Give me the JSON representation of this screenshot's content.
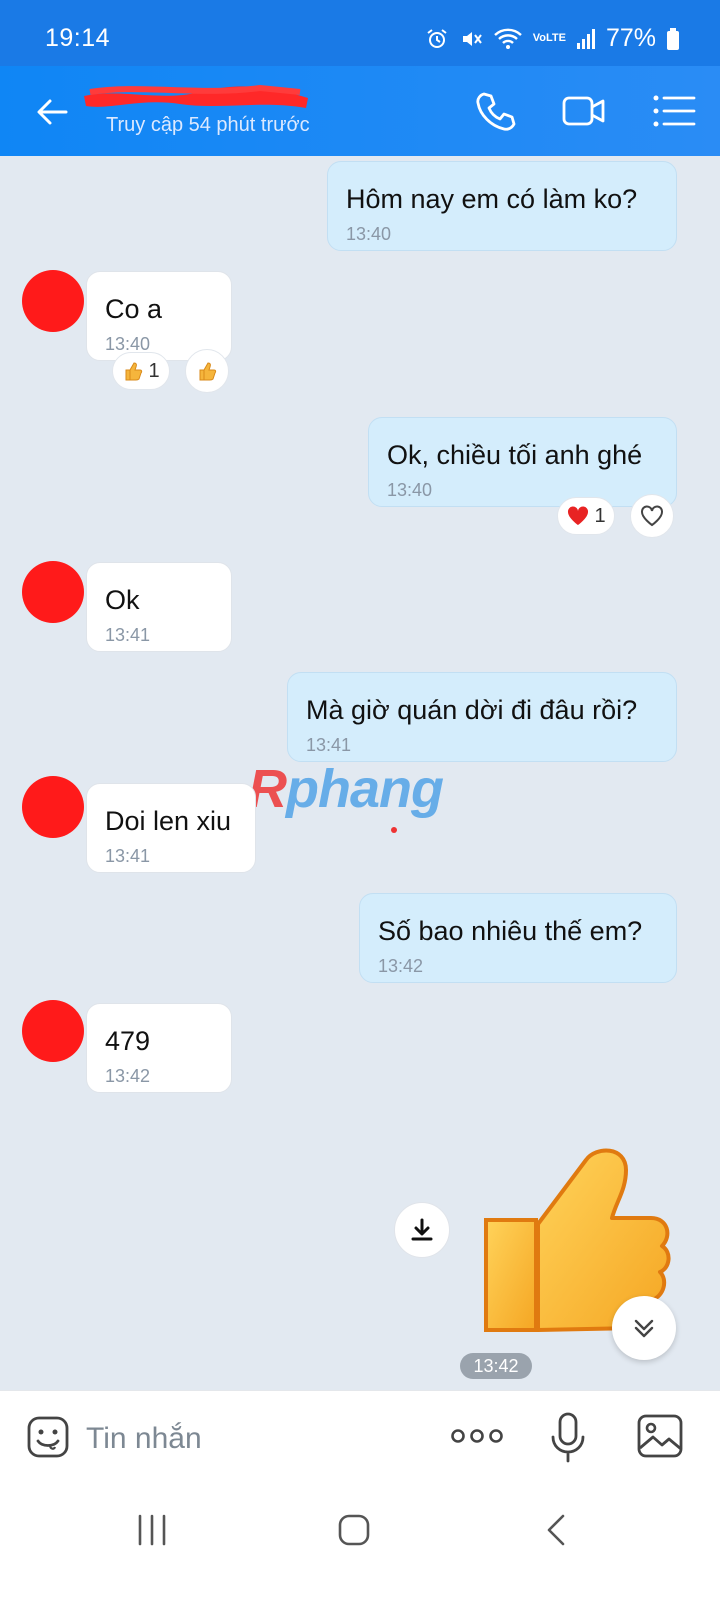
{
  "status_bar": {
    "time": "19:14",
    "battery_percent": "77%",
    "network_label": "VoLTE"
  },
  "header": {
    "last_seen": "Truy cập 54 phút trước"
  },
  "messages": [
    {
      "direction": "out",
      "text": "Hôm nay em có làm ko?",
      "time": "13:40"
    },
    {
      "direction": "in",
      "text": "Co a",
      "time": "13:40",
      "reactions": [
        {
          "emoji": "thumbs-up",
          "count": "1"
        },
        {
          "emoji": "thumbs-up",
          "count": ""
        }
      ]
    },
    {
      "direction": "out",
      "text": "Ok, chiều tối anh ghé",
      "time": "13:40",
      "reactions": [
        {
          "emoji": "red-heart",
          "count": "1"
        },
        {
          "emoji": "heart-outline",
          "count": ""
        }
      ]
    },
    {
      "direction": "in",
      "text": "Ok",
      "time": "13:41"
    },
    {
      "direction": "out",
      "text": "Mà giờ quán dời đi đâu rồi?",
      "time": "13:41"
    },
    {
      "direction": "in",
      "text": "Doi len xiu",
      "time": "13:41"
    },
    {
      "direction": "out",
      "text": "Số bao nhiêu thế em?",
      "time": "13:42"
    },
    {
      "direction": "in",
      "text": "479",
      "time": "13:42"
    }
  ],
  "sticker": {
    "name": "thumbs-up-sticker",
    "time": "13:42"
  },
  "watermark": {
    "first": "R",
    "rest": "phang"
  },
  "input": {
    "placeholder": "Tin nhắn"
  },
  "colors": {
    "header": "#1a86f5",
    "outgoing_bubble": "#d4edfc",
    "incoming_bubble": "#ffffff",
    "background": "#e2e9f1"
  }
}
